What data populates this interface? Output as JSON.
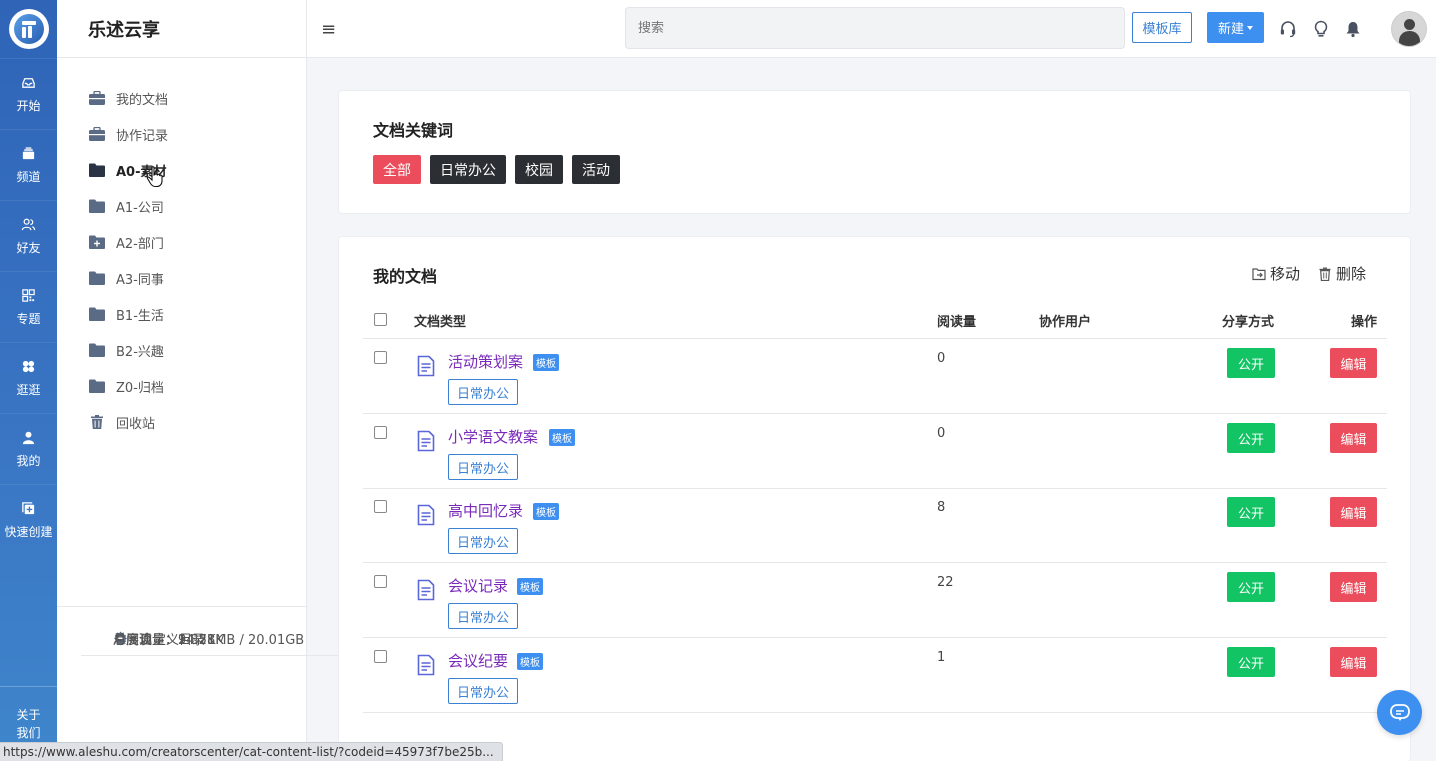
{
  "rail": {
    "items": [
      {
        "label": "开始",
        "icon": "inbox-icon"
      },
      {
        "label": "频道",
        "icon": "stack-icon"
      },
      {
        "label": "好友",
        "icon": "friends-icon"
      },
      {
        "label": "专题",
        "icon": "grid-icon"
      },
      {
        "label": "逛逛",
        "icon": "clover-icon"
      },
      {
        "label": "我的",
        "icon": "user-icon"
      },
      {
        "label": "快速创建",
        "icon": "quick-create-icon"
      }
    ],
    "about_line1": "关于",
    "about_line2": "我们"
  },
  "sidebar": {
    "brand": "乐述云享",
    "items": [
      {
        "label": "我的文档",
        "icon": "briefcase-icon"
      },
      {
        "label": "协作记录",
        "icon": "briefcase-icon"
      },
      {
        "label": "A0-素材",
        "icon": "folder-icon",
        "active": true
      },
      {
        "label": "A1-公司",
        "icon": "folder-icon"
      },
      {
        "label": "A2-部门",
        "icon": "folder-plus-icon"
      },
      {
        "label": "A3-同事",
        "icon": "folder-icon"
      },
      {
        "label": "B1-生活",
        "icon": "folder-icon"
      },
      {
        "label": "B2-兴趣",
        "icon": "folder-icon"
      },
      {
        "label": "Z0-归档",
        "icon": "folder-icon"
      },
      {
        "label": "回收站",
        "icon": "trash-icon"
      }
    ],
    "custom_dir": "自定义目录",
    "monthly_traffic": "月度流量：94.21MB / 20.01GB",
    "total_reads": "总阅读量：2.87K",
    "total_impressions": "总展现量：14.58K"
  },
  "topbar": {
    "search_placeholder": "搜索",
    "template_lib": "模板库",
    "new_label": "新建"
  },
  "keywords": {
    "title": "文档关键词",
    "tags": [
      "全部",
      "日常办公",
      "校园",
      "活动"
    ],
    "active_index": 0
  },
  "docs": {
    "title": "我的文档",
    "move_label": "移动",
    "delete_label": "删除",
    "headers": {
      "type": "文档类型",
      "reads": "阅读量",
      "collaborators": "协作用户",
      "share": "分享方式",
      "ops": "操作"
    },
    "rows": [
      {
        "name": "活动策划案",
        "badge": "模板",
        "category": "日常办公",
        "reads": "0",
        "share": "公开",
        "edit": "编辑"
      },
      {
        "name": "小学语文教案",
        "badge": "模板",
        "category": "日常办公",
        "reads": "0",
        "share": "公开",
        "edit": "编辑"
      },
      {
        "name": "高中回忆录",
        "badge": "模板",
        "category": "日常办公",
        "reads": "8",
        "share": "公开",
        "edit": "编辑"
      },
      {
        "name": "会议记录",
        "badge": "模板",
        "category": "日常办公",
        "reads": "22",
        "share": "公开",
        "edit": "编辑"
      },
      {
        "name": "会议纪要",
        "badge": "模板",
        "category": "日常办公",
        "reads": "1",
        "share": "公开",
        "edit": "编辑"
      }
    ]
  },
  "status_url": "https://www.aleshu.com/creatorscenter/cat-content-list/?codeid=45973f7be25b...",
  "colors": {
    "rail": "#2f64b7",
    "accent": "#3d8ff0",
    "danger": "#eb4d5c",
    "success": "#13c465",
    "doc_name": "#7a2ab9"
  }
}
